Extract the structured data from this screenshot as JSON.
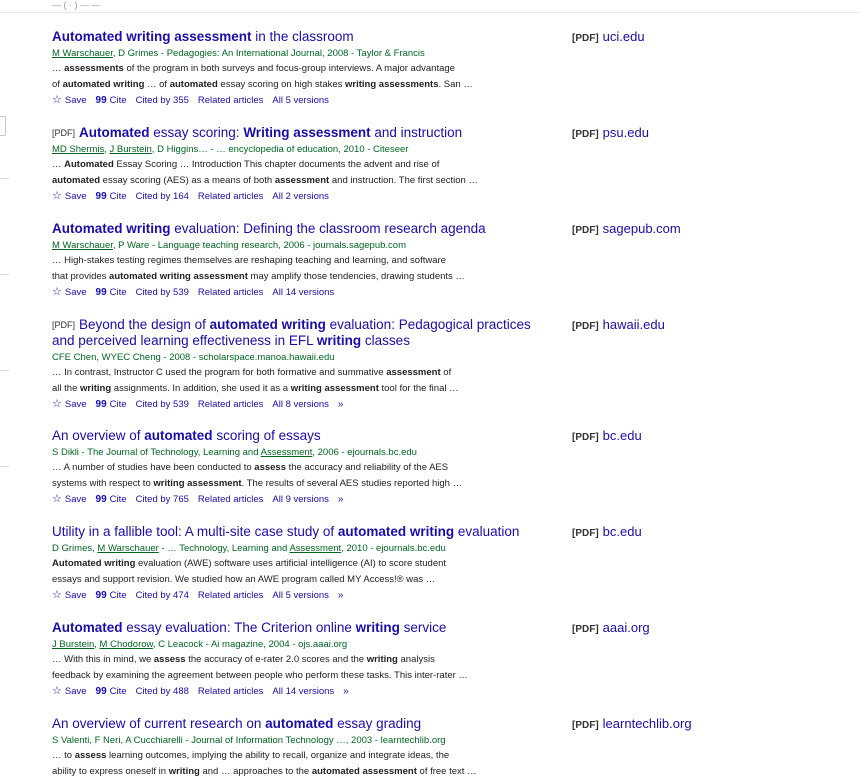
{
  "top_fragment": "— (  ·  ) — —",
  "labels": {
    "save": "Save",
    "cite": "Cite",
    "related": "Related articles",
    "pdf_tag": "[PDF]",
    "more_glyph": "»"
  },
  "results": [
    {
      "title_parts": [
        [
          "Automated writing assessment",
          true
        ],
        [
          " in the classroom",
          false
        ]
      ],
      "pdf_prefix": false,
      "authors": [
        [
          "M Warschauer",
          true
        ],
        [
          ", D Grimes - Pedagogies: An International Journal, 2008 - Taylor & Francis",
          false
        ]
      ],
      "snippet1": [
        [
          "… ",
          false
        ],
        [
          "assessments",
          true
        ],
        [
          " of the program in both surveys and focus-group interviews. A major advantage",
          false
        ]
      ],
      "snippet2": [
        [
          "of ",
          false
        ],
        [
          "automated writing",
          true
        ],
        [
          " … of ",
          false
        ],
        [
          "automated",
          true
        ],
        [
          " essay scoring on high stakes ",
          false
        ],
        [
          "writing assessments",
          true
        ],
        [
          ". San …",
          false
        ]
      ],
      "cited": "Cited by 355",
      "versions": "All 5 versions",
      "more": false,
      "side": "uci.edu"
    },
    {
      "title_parts": [
        [
          "Automated",
          true
        ],
        [
          " essay scoring: ",
          false
        ],
        [
          "Writing assessment",
          true
        ],
        [
          " and instruction",
          false
        ]
      ],
      "pdf_prefix": true,
      "authors": [
        [
          "MD Shermis",
          true
        ],
        [
          ", ",
          false
        ],
        [
          "J Burstein",
          true
        ],
        [
          ", D Higgins… - … encyclopedia of education, 2010 - Citeseer",
          false
        ]
      ],
      "snippet1": [
        [
          "… ",
          false
        ],
        [
          "Automated",
          true
        ],
        [
          " Essay Scoring … Introduction This chapter documents the advent and rise of",
          false
        ]
      ],
      "snippet2": [
        [
          "automated",
          true
        ],
        [
          " essay scoring (AES) as a means of both ",
          false
        ],
        [
          "assessment",
          true
        ],
        [
          " and instruction. The first section …",
          false
        ]
      ],
      "cited": "Cited by 164",
      "versions": "All 2 versions",
      "more": false,
      "side": "psu.edu"
    },
    {
      "title_parts": [
        [
          "Automated writing",
          true
        ],
        [
          " evaluation: Defining the classroom research agenda",
          false
        ]
      ],
      "pdf_prefix": false,
      "authors": [
        [
          "M Warschauer",
          true
        ],
        [
          ", P Ware - Language teaching research, 2006 - journals.sagepub.com",
          false
        ]
      ],
      "snippet1": [
        [
          "… High-stakes testing regimes themselves are reshaping teaching and learning, and software",
          false
        ]
      ],
      "snippet2": [
        [
          "that provides ",
          false
        ],
        [
          "automated writing assessment",
          true
        ],
        [
          " may amplify those tendencies, drawing students …",
          false
        ]
      ],
      "cited": "Cited by 539",
      "versions": "All 14 versions",
      "more": false,
      "side": "sagepub.com"
    },
    {
      "title_parts": [
        [
          "Beyond the design of ",
          false
        ],
        [
          "automated writing",
          true
        ],
        [
          " evaluation: Pedagogical practices",
          false
        ]
      ],
      "title_line2": [
        [
          "and perceived learning effectiveness in EFL ",
          false
        ],
        [
          "writing",
          true
        ],
        [
          " classes",
          false
        ]
      ],
      "pdf_prefix": true,
      "authors": [
        [
          "CFE Chen, WYEC Cheng - 2008 - scholarspace.manoa.hawaii.edu",
          false
        ]
      ],
      "snippet1": [
        [
          "… In contrast, Instructor C used the program for both formative and summative ",
          false
        ],
        [
          "assessment",
          true
        ],
        [
          " of",
          false
        ]
      ],
      "snippet2": [
        [
          "all the ",
          false
        ],
        [
          "writing",
          true
        ],
        [
          " assignments. In addition, she used it as a ",
          false
        ],
        [
          "writing assessment",
          true
        ],
        [
          " tool for the final …",
          false
        ]
      ],
      "cited": "Cited by 539",
      "versions": "All 8 versions",
      "more": true,
      "side": "hawaii.edu"
    },
    {
      "title_parts": [
        [
          "An overview of ",
          false
        ],
        [
          "automated",
          true
        ],
        [
          " scoring of essays",
          false
        ]
      ],
      "pdf_prefix": false,
      "authors": [
        [
          "S Dikli - The Journal of Technology, Learning and ",
          false
        ],
        [
          "Assessment",
          true
        ],
        [
          ", 2006 - ejournals.bc.edu",
          false
        ]
      ],
      "snippet1": [
        [
          "… A number of studies have been conducted to ",
          false
        ],
        [
          "assess",
          true
        ],
        [
          " the accuracy and reliability of the AES",
          false
        ]
      ],
      "snippet2": [
        [
          "systems with respect to ",
          false
        ],
        [
          "writing assessment",
          true
        ],
        [
          ". The results of several AES studies reported high …",
          false
        ]
      ],
      "cited": "Cited by 765",
      "versions": "All 9 versions",
      "more": true,
      "side": "bc.edu"
    },
    {
      "title_parts": [
        [
          "Utility in a fallible tool: A multi-site case study of ",
          false
        ],
        [
          "automated writing",
          true
        ],
        [
          " evaluation",
          false
        ]
      ],
      "pdf_prefix": false,
      "authors": [
        [
          "D Grimes, ",
          false
        ],
        [
          "M Warschauer",
          true
        ],
        [
          " - … Technology, Learning and ",
          false
        ],
        [
          "Assessment",
          true
        ],
        [
          ", 2010 - ejournals.bc.edu",
          false
        ]
      ],
      "snippet1": [
        [
          "Automated writing",
          true
        ],
        [
          " evaluation (AWE) software uses artificial intelligence (AI) to score student",
          false
        ]
      ],
      "snippet2": [
        [
          "essays and support revision. We studied how an AWE program called MY Access!® was …",
          false
        ]
      ],
      "cited": "Cited by 474",
      "versions": "All 5 versions",
      "more": true,
      "side": "bc.edu"
    },
    {
      "title_parts": [
        [
          "Automated",
          true
        ],
        [
          " essay evaluation: The Criterion online ",
          false
        ],
        [
          "writing",
          true
        ],
        [
          " service",
          false
        ]
      ],
      "pdf_prefix": false,
      "authors": [
        [
          "J Burstein",
          true
        ],
        [
          ", ",
          false
        ],
        [
          "M Chodorow",
          true
        ],
        [
          ", C Leacock - Ai magazine, 2004 - ojs.aaai.org",
          false
        ]
      ],
      "snippet1": [
        [
          "… With this in mind, we ",
          false
        ],
        [
          "assess",
          true
        ],
        [
          " the accuracy of e-rater 2.0 scores and the ",
          false
        ],
        [
          "writing",
          true
        ],
        [
          " analysis",
          false
        ]
      ],
      "snippet2": [
        [
          "feedback by examining the agreement between people who perform these tasks. This inter-rater …",
          false
        ]
      ],
      "cited": "Cited by 488",
      "versions": "All 14 versions",
      "more": true,
      "side": "aaai.org"
    },
    {
      "title_parts": [
        [
          "An overview of current research on ",
          false
        ],
        [
          "automated",
          true
        ],
        [
          " essay grading",
          false
        ]
      ],
      "pdf_prefix": false,
      "authors": [
        [
          "S Valenti, F Neri, A Cucchiarelli - Journal of Information Technology …, 2003 - learntechlib.org",
          false
        ]
      ],
      "snippet1": [
        [
          "… to ",
          false
        ],
        [
          "assess",
          true
        ],
        [
          " learning outcomes, implying the ability to recall, organize and integrate ideas, the",
          false
        ]
      ],
      "snippet2": [
        [
          "ability to express oneself in ",
          false
        ],
        [
          "writing",
          true
        ],
        [
          " and … approaches to the ",
          false
        ],
        [
          "automated assessment",
          true
        ],
        [
          " of free text …",
          false
        ]
      ],
      "cited": "",
      "versions": "",
      "more": false,
      "side": "learntechlib.org"
    }
  ]
}
